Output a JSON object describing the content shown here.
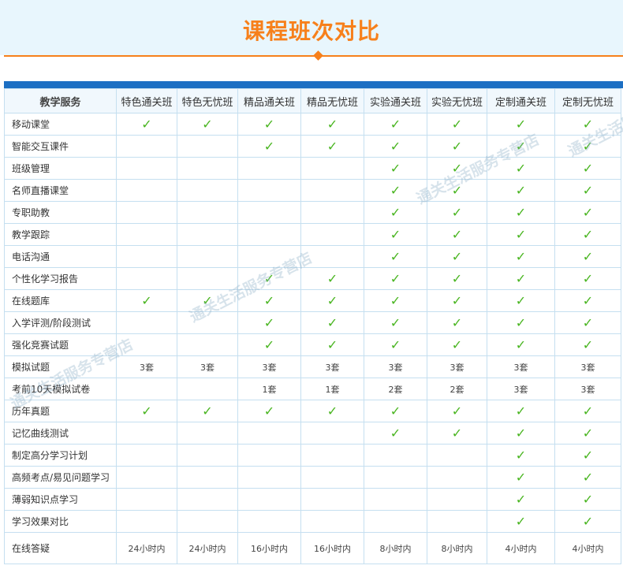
{
  "title": "课程班次对比",
  "watermark_text": "通关生活服务专营店",
  "check_symbol": "✓",
  "colors": {
    "accent": "#f7801b",
    "band": "#1c6fc3",
    "check": "#49b520",
    "header_bg": "#e8f6fd"
  },
  "table": {
    "corner_label": "教学服务",
    "columns": [
      "特色通关班",
      "特色无忧班",
      "精品通关班",
      "精品无忧班",
      "实验通关班",
      "实验无忧班",
      "定制通关班",
      "定制无忧班"
    ],
    "rows": [
      {
        "label": "移动课堂",
        "cells": [
          "✓",
          "✓",
          "✓",
          "✓",
          "✓",
          "✓",
          "✓",
          "✓"
        ]
      },
      {
        "label": "智能交互课件",
        "cells": [
          "",
          "",
          "✓",
          "✓",
          "✓",
          "✓",
          "✓",
          "✓"
        ]
      },
      {
        "label": "班级管理",
        "cells": [
          "",
          "",
          "",
          "",
          "✓",
          "✓",
          "✓",
          "✓"
        ]
      },
      {
        "label": "名师直播课堂",
        "cells": [
          "",
          "",
          "",
          "",
          "✓",
          "✓",
          "✓",
          "✓"
        ]
      },
      {
        "label": "专职助教",
        "cells": [
          "",
          "",
          "",
          "",
          "✓",
          "✓",
          "✓",
          "✓"
        ]
      },
      {
        "label": "教学跟踪",
        "cells": [
          "",
          "",
          "",
          "",
          "✓",
          "✓",
          "✓",
          "✓"
        ]
      },
      {
        "label": "电话沟通",
        "cells": [
          "",
          "",
          "",
          "",
          "✓",
          "✓",
          "✓",
          "✓"
        ]
      },
      {
        "label": "个性化学习报告",
        "cells": [
          "",
          "",
          "✓",
          "✓",
          "✓",
          "✓",
          "✓",
          "✓"
        ]
      },
      {
        "label": "在线题库",
        "cells": [
          "✓",
          "✓",
          "✓",
          "✓",
          "✓",
          "✓",
          "✓",
          "✓"
        ]
      },
      {
        "label": "入学评测/阶段测试",
        "cells": [
          "",
          "",
          "✓",
          "✓",
          "✓",
          "✓",
          "✓",
          "✓"
        ]
      },
      {
        "label": "强化竞赛试题",
        "cells": [
          "",
          "",
          "✓",
          "✓",
          "✓",
          "✓",
          "✓",
          "✓"
        ]
      },
      {
        "label": "模拟试题",
        "cells": [
          "3套",
          "3套",
          "3套",
          "3套",
          "3套",
          "3套",
          "3套",
          "3套"
        ]
      },
      {
        "label": "考前10天模拟试卷",
        "cells": [
          "",
          "",
          "1套",
          "1套",
          "2套",
          "2套",
          "3套",
          "3套"
        ]
      },
      {
        "label": "历年真题",
        "cells": [
          "✓",
          "✓",
          "✓",
          "✓",
          "✓",
          "✓",
          "✓",
          "✓"
        ]
      },
      {
        "label": "记忆曲线测试",
        "cells": [
          "",
          "",
          "",
          "",
          "✓",
          "✓",
          "✓",
          "✓"
        ]
      },
      {
        "label": "制定高分学习计划",
        "cells": [
          "",
          "",
          "",
          "",
          "",
          "",
          "✓",
          "✓"
        ]
      },
      {
        "label": "高频考点/易见问题学习",
        "cells": [
          "",
          "",
          "",
          "",
          "",
          "",
          "✓",
          "✓"
        ]
      },
      {
        "label": "薄弱知识点学习",
        "cells": [
          "",
          "",
          "",
          "",
          "",
          "",
          "✓",
          "✓"
        ]
      },
      {
        "label": "学习效果对比",
        "cells": [
          "",
          "",
          "",
          "",
          "",
          "",
          "✓",
          "✓"
        ]
      },
      {
        "label": "在线答疑",
        "cells": [
          "24小时内",
          "24小时内",
          "16小时内",
          "16小时内",
          "8小时内",
          "8小时内",
          "4小时内",
          "4小时内"
        ]
      }
    ]
  }
}
